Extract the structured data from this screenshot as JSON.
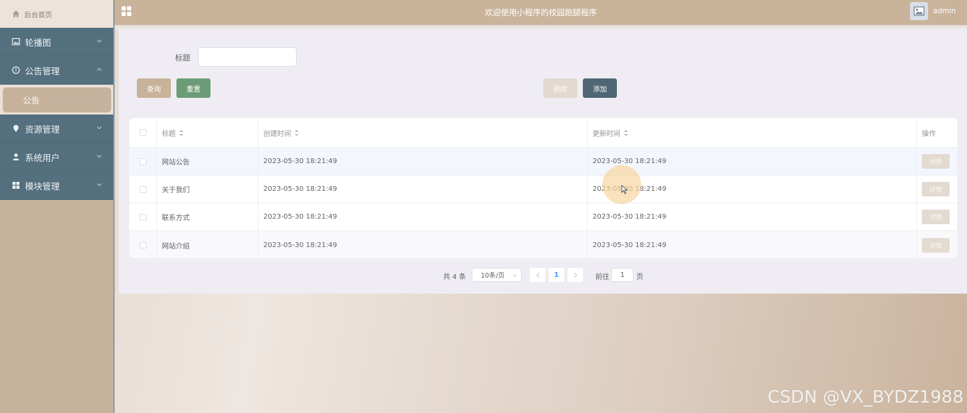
{
  "sidebar": {
    "home_label": "后台首页",
    "items": [
      {
        "label": "轮播图",
        "icon": "picture-icon",
        "expanded": false
      },
      {
        "label": "公告管理",
        "icon": "info-icon",
        "expanded": true
      },
      {
        "label": "资源管理",
        "icon": "location-icon",
        "expanded": false
      },
      {
        "label": "系统用户",
        "icon": "user-icon",
        "expanded": false
      },
      {
        "label": "模块管理",
        "icon": "menu-icon",
        "expanded": false
      }
    ],
    "submenu": [
      {
        "label": "公告",
        "active": true
      }
    ]
  },
  "header": {
    "title": "欢迎使用小程序的校园跑腿程序",
    "username": "admin"
  },
  "search": {
    "title_label": "标题",
    "title_value": "",
    "query_label": "查询",
    "reset_label": "重置",
    "delete_label": "删除",
    "add_label": "添加"
  },
  "table": {
    "columns": [
      "标题",
      "创建时间",
      "更新时间",
      "操作"
    ],
    "rows": [
      {
        "title": "网站公告",
        "created": "2023-05-30 18:21:49",
        "updated": "2023-05-30 18:21:49",
        "action": "详情"
      },
      {
        "title": "关于我们",
        "created": "2023-05-30 18:21:49",
        "updated": "2023-05-30 18:21:49",
        "action": "详情"
      },
      {
        "title": "联系方式",
        "created": "2023-05-30 18:21:49",
        "updated": "2023-05-30 18:21:49",
        "action": "详情"
      },
      {
        "title": "网站介绍",
        "created": "2023-05-30 18:21:49",
        "updated": "2023-05-30 18:21:49",
        "action": "详情"
      }
    ]
  },
  "pagination": {
    "total_text": "共 4 条",
    "page_size": "10条/页",
    "current_page": "1",
    "goto_label": "前往",
    "goto_value": "1",
    "unit_label": "页"
  },
  "watermark": "CSDN @VX_BYDZ1988",
  "colors": {
    "sidebar_menu": "#546f7e",
    "header": "#c9b49b",
    "query_button": "#c7b29a",
    "reset_button": "#6c9c76",
    "add_button": "#4f6675",
    "delete_button": "#e2d9d0"
  }
}
